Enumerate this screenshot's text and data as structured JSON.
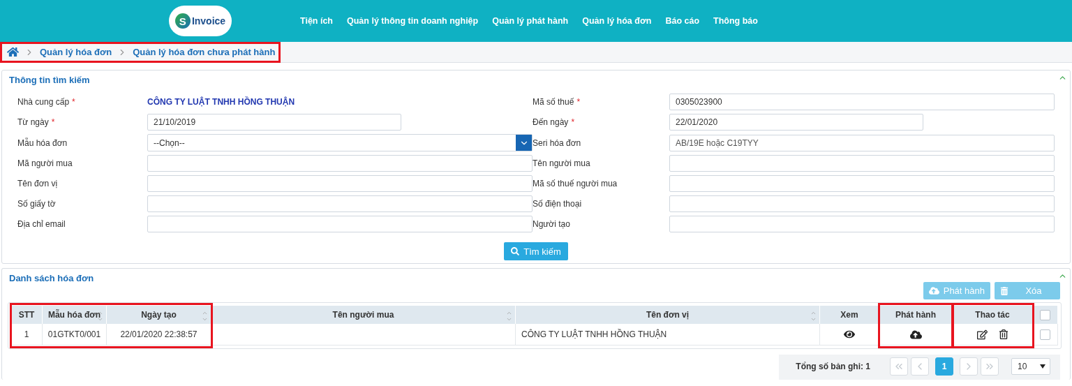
{
  "header": {
    "logo": {
      "initial": "S",
      "name": "Invoice"
    },
    "nav": [
      {
        "label": "Tiện ích"
      },
      {
        "label": "Quản lý thông tin doanh nghiệp"
      },
      {
        "label": "Quản lý phát hành"
      },
      {
        "label": "Quản lý hóa đơn"
      },
      {
        "label": "Báo cáo"
      },
      {
        "label": "Thông báo"
      }
    ]
  },
  "breadcrumb": {
    "highlighted": true,
    "items": [
      "Quản lý hóa đơn",
      "Quản lý hóa đơn chưa phát hành"
    ]
  },
  "search_panel": {
    "title": "Thông tin tìm kiếm",
    "expanded": true,
    "fields": [
      {
        "label": "Nhà cung cấp",
        "required_mark": "*",
        "kind": "static",
        "value": "CÔNG TY LUẬT TNHH HỒNG THUẬN"
      },
      {
        "label": "Mã số thuế",
        "required_mark": "*",
        "kind": "input",
        "value": "0305023900",
        "short": false
      },
      {
        "label": "Từ ngày",
        "required_mark": "*",
        "kind": "input",
        "value": "21/10/2019",
        "short": true
      },
      {
        "label": "Đến ngày",
        "required_mark": "*",
        "kind": "input",
        "value": "22/01/2020",
        "short": true
      },
      {
        "label": "Mẫu hóa đơn",
        "kind": "select",
        "value": "--Chọn--"
      },
      {
        "label": "Seri hóa đơn",
        "kind": "input",
        "placeholder": "AB/19E hoặc C19TYY",
        "short": false
      },
      {
        "label": "Mã người mua",
        "kind": "input",
        "short": false
      },
      {
        "label": "Tên người mua",
        "kind": "input",
        "short": false
      },
      {
        "label": "Tên đơn vị",
        "kind": "input",
        "short": false
      },
      {
        "label": "Mã số thuế người mua",
        "kind": "input",
        "short": false
      },
      {
        "label": "Số giấy tờ",
        "kind": "input",
        "short": false
      },
      {
        "label": "Số điện thoại",
        "kind": "input",
        "short": false
      },
      {
        "label": "Địa chỉ email",
        "kind": "input",
        "short": false
      },
      {
        "label": "Người tạo",
        "kind": "input",
        "short": false
      }
    ],
    "search_button": "Tìm kiếm"
  },
  "list_panel": {
    "title": "Danh sách hóa đơn",
    "expanded": true,
    "actions": [
      {
        "label": "Phát hành",
        "kind": "publish",
        "disabled": true
      },
      {
        "label": "Xóa",
        "kind": "delete",
        "disabled": true
      }
    ],
    "table": {
      "columns": [
        {
          "label": "STT",
          "kind": "text",
          "sortable": false,
          "boxed": true
        },
        {
          "label": "Mẫu hóa đơn",
          "kind": "text",
          "sortable": true,
          "boxed": true,
          "box_start": false
        },
        {
          "label": "Ngày tạo",
          "kind": "text",
          "sortable": true,
          "boxed": true,
          "box_start": false
        },
        {
          "label": "Tên người mua",
          "kind": "text",
          "sortable": true,
          "boxed": false
        },
        {
          "label": "Tên đơn vị",
          "kind": "text",
          "sortable": true,
          "boxed": false
        },
        {
          "label": "Xem",
          "kind": "view",
          "sortable": false,
          "boxed": false
        },
        {
          "label": "Phát hành",
          "kind": "publish",
          "sortable": false,
          "boxed": true
        },
        {
          "label": "Thao tác",
          "kind": "actions",
          "sortable": false,
          "boxed": true,
          "box_start": true
        },
        {
          "kind": "check",
          "checked": false,
          "boxed": false
        }
      ],
      "rows": [
        {
          "cells": [
            "1",
            "01GTKT0/001",
            "22/01/2020 22:38:57",
            "",
            "CÔNG TY LUẬT TNHH HỒNG THUẬN"
          ],
          "checked": false
        }
      ]
    },
    "pagination": {
      "total": "Tổng số bản ghi: 1",
      "pages": [
        {
          "label": "1",
          "selected": true
        }
      ],
      "page_size": "10"
    }
  }
}
